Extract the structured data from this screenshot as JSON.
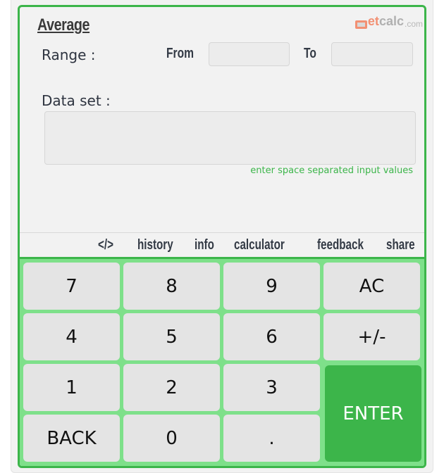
{
  "calculator": {
    "title": "Average",
    "logo": {
      "prefix": "g",
      "accent": "et",
      "main": "calc",
      "suffix": ".com"
    },
    "range": {
      "label": "Range :",
      "from_label": "From",
      "to_label": "To",
      "from_value": "",
      "to_value": ""
    },
    "dataset": {
      "label": "Data set :",
      "value": "",
      "hint": "enter space separated input values"
    },
    "menu": [
      "</>",
      "history",
      "info",
      "calculator",
      "feedback",
      "share"
    ],
    "keys": {
      "k7": "7",
      "k8": "8",
      "k9": "9",
      "ac": "AC",
      "k4": "4",
      "k5": "5",
      "k6": "6",
      "sign": "+/-",
      "k1": "1",
      "k2": "2",
      "k3": "3",
      "enter": "ENTER",
      "back": "BACK",
      "k0": "0",
      "dot": "."
    },
    "colors": {
      "accent": "#3cb54a",
      "keypad_bg": "#7ee08a",
      "key_bg": "#e4e4e4",
      "logo_accent": "#f29073"
    }
  }
}
